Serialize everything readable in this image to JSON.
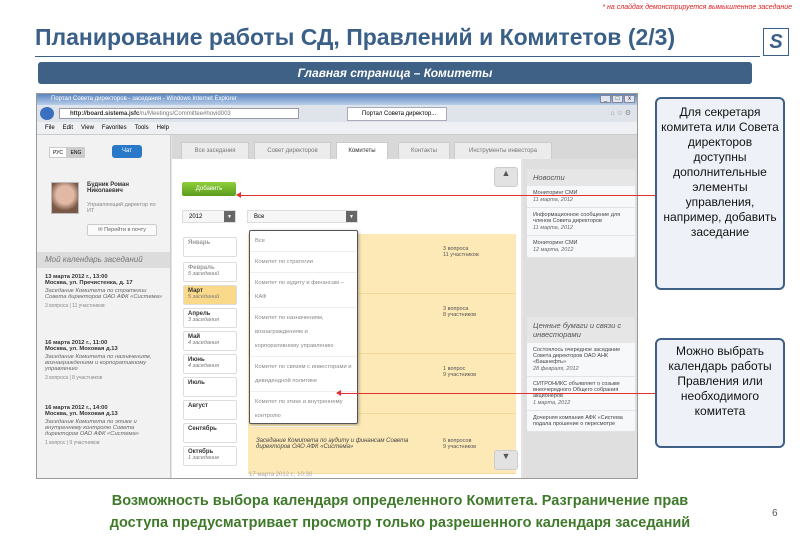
{
  "slide": {
    "note": "* на слайдах демонстрируется вымышленное заседание",
    "title": "Планирование работы СД, Правлений и Комитетов (2/3)",
    "logo": "S",
    "banner": "Главная страница – Комитеты",
    "bottom_line1": "Возможность выбора календаря определенного Комитета. Разграничение прав",
    "bottom_line2": "доступа предусматривает просмотр только разрешенного календаря заседаний",
    "page_number": "6",
    "callouts": [
      "Для секретаря комитета или Совета директоров доступны дополнительные элементы управления, например, добавить заседание",
      "Можно выбрать календарь работы Правления или необходимого комитета"
    ],
    "arrow_color": "#e03030"
  },
  "browser": {
    "title": "Портал Совета директоров - заседания - Windows Internet Explorer",
    "url_host": "http://board.sistema.jsfc",
    "url_path": "/ru/Meetings/Committee#hovid003",
    "tab": "Портал Совета директор...",
    "menu": [
      "File",
      "Edit",
      "View",
      "Favorites",
      "Tools",
      "Help"
    ],
    "win_buttons": [
      "_",
      "□",
      "x"
    ]
  },
  "sidebar": {
    "lang_ru": "РУС",
    "lang_en": "ENG",
    "chat": "Чат",
    "user_name": "Будник Роман Николаевич",
    "user_role": "Управляющий директор по ИТ",
    "mail_button": "Перейти в почту",
    "calendar_title": "Мой календарь заседаний",
    "events": [
      {
        "date": "13 марта 2012 г., 13:00",
        "place": "Москва, ул. Пречистенка, д. 17",
        "title": "Заседание Комитета по стратегии Совета директоров ОАО АФК «Система»",
        "counts": "3 вопроса  |  11 участников"
      },
      {
        "date": "16 марта 2012 г., 11:00",
        "place": "Москва, ул. Моховая д.13",
        "title": "Заседание Комитета по назначениям, вознаграждениям и корпоративному управлению",
        "counts": "3 вопроса  |  8 участников"
      },
      {
        "date": "16 марта 2012 г., 14:00",
        "place": "Москва, ул. Моховая д.13",
        "title": "Заседание Комитета по этике и внутреннему контролю Совета директоров ОАО АФК «Система»",
        "counts": "1 вопрос  |  9 участников"
      }
    ]
  },
  "tabs": [
    "Все заседания",
    "Совет директоров",
    "Комитеты",
    "Контакты",
    "Инструменты инвестора"
  ],
  "main": {
    "add_button": "Добавить",
    "year": "2012",
    "committee_select": "Все",
    "months": [
      {
        "name": "Январь",
        "count": ""
      },
      {
        "name": "Февраль",
        "count": "5 заседаний"
      },
      {
        "name": "Март",
        "count": "5 заседаний"
      },
      {
        "name": "Апрель",
        "count": "3 заседания"
      },
      {
        "name": "Май",
        "count": "4 заседания"
      },
      {
        "name": "Июнь",
        "count": "4 заседания"
      },
      {
        "name": "Июль",
        "count": ""
      },
      {
        "name": "Август",
        "count": ""
      },
      {
        "name": "Сентябрь",
        "count": ""
      },
      {
        "name": "Октябрь",
        "count": "1 заседание"
      }
    ],
    "meetings": [
      {
        "desc": "",
        "q": "3 вопроса",
        "p": "11 участников"
      },
      {
        "desc": "",
        "q": "3 вопроса",
        "p": "8 участников"
      },
      {
        "desc": "",
        "q": "1 вопрос",
        "p": "9 участников"
      },
      {
        "desc": "Заседание Комитета по аудиту и финансам Совета директоров ОАО АФК «Система»",
        "q": "6 вопросов",
        "p": "9 участников"
      }
    ],
    "next_meeting": "17 марта 2012 г., 10:30",
    "dropdown": [
      "Все",
      "Комитет по стратегии",
      "Комитет по аудиту и финансам – КАФ",
      "Комитет по назначениям, вознаграждениям и корпоративному управлению",
      "Комитет по связям с инвесторами и дивидендной политике",
      "Комитет по этике и внутреннему контролю"
    ]
  },
  "right": {
    "news_title": "Новости",
    "news": [
      {
        "text": "Мониторинг СМИ",
        "date": "11 марта, 2012"
      },
      {
        "text": "Информационное сообщение для членов Совета директоров",
        "date": "11 марта, 2012"
      },
      {
        "text": "Мониторинг СМИ",
        "date": "12 марта, 2012"
      }
    ],
    "sec_title": "Ценные бумаги и связи с инвесторами",
    "sec": [
      {
        "text": "Состоялось очередное заседание Совета директоров ОАО АНК «Башнефть»",
        "date": "28 февраля, 2012"
      },
      {
        "text": "СИТРОНИКС объявляет о созыве внеочередного Общего собрания акционеров",
        "date": "1 марта, 2012"
      },
      {
        "text": "Дочерняя компания АФК «Система подала прошение о пересмотре",
        "date": ""
      }
    ]
  }
}
